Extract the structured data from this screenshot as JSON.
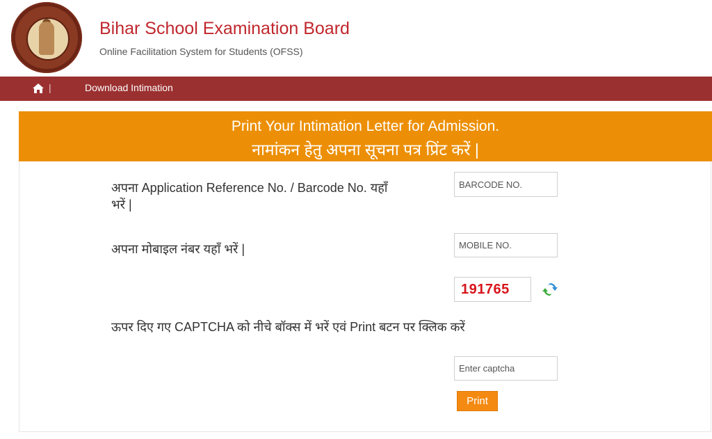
{
  "header": {
    "title": "Bihar School Examination Board",
    "subtitle": "Online Facilitation System for Students (OFSS)"
  },
  "nav": {
    "home_icon": "home-icon",
    "separator": "|",
    "link": "Download Intimation"
  },
  "banner": {
    "line1": "Print Your Intimation Letter for Admission.",
    "line2": "नामांकन हेतु अपना सूचना पत्र प्रिंट करें |"
  },
  "form": {
    "barcode_label_line1": "अपना Application Reference No. / Barcode No. यहाँ",
    "barcode_label_line2": "भरें |",
    "barcode_placeholder": "BARCODE NO.",
    "mobile_label": "अपना मोबाइल नंबर यहाँ भरें |",
    "mobile_placeholder": "MOBILE NO.",
    "captcha_value": "191765",
    "refresh_icon": "refresh-icon",
    "captcha_instruction": "ऊपर दिए गए CAPTCHA को नीचे बॉक्स में भरें एवं Print बटन पर क्लिक करें",
    "captcha_placeholder": "Enter captcha",
    "print_label": "Print"
  },
  "colors": {
    "title_red": "#c0272d",
    "nav_bar": "#9b3030",
    "banner_orange": "#ec8f06",
    "captcha_red": "#d8141b",
    "button_orange": "#f48a12"
  }
}
